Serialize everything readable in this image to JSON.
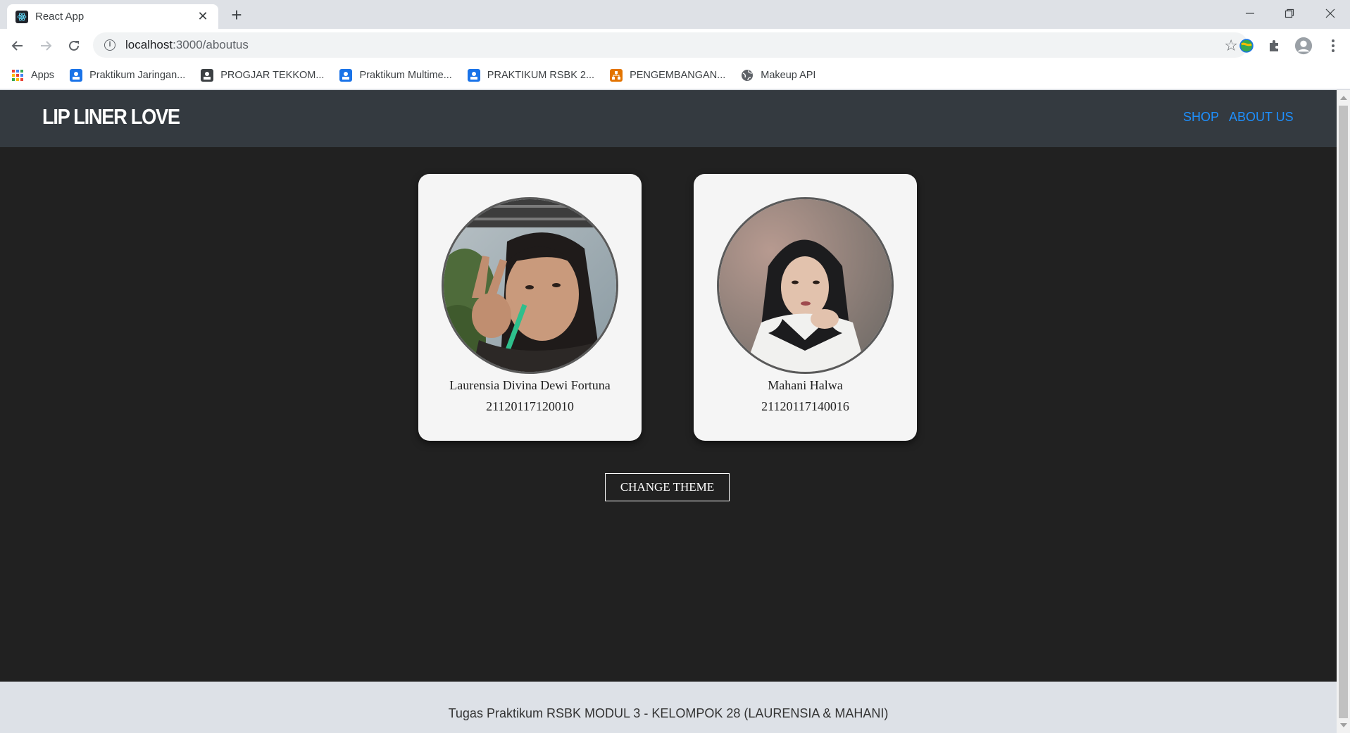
{
  "browser": {
    "tab_title": "React App",
    "url_host": "localhost",
    "url_rest": ":3000/aboutus",
    "bookmarks": [
      {
        "label": "Apps",
        "icon": "apps-grid-icon",
        "color": "#ea4335"
      },
      {
        "label": "Praktikum Jaringan...",
        "icon": "classroom-icon",
        "color": "#1a73e8"
      },
      {
        "label": "PROGJAR TEKKOM...",
        "icon": "classroom-icon",
        "color": "#3c4043"
      },
      {
        "label": "Praktikum Multime...",
        "icon": "classroom-icon",
        "color": "#1a73e8"
      },
      {
        "label": "PRAKTIKUM RSBK 2...",
        "icon": "classroom-icon",
        "color": "#1a73e8"
      },
      {
        "label": "PENGEMBANGAN...",
        "icon": "org-icon",
        "color": "#e37400"
      },
      {
        "label": "Makeup API",
        "icon": "globe-icon",
        "color": "#5f6368"
      }
    ]
  },
  "navbar": {
    "brand": "LIP LINER LOVE",
    "links": [
      "SHOP",
      "ABOUT US"
    ]
  },
  "members": [
    {
      "name": "Laurensia Divina Dewi Fortuna",
      "id": "21120117120010"
    },
    {
      "name": "Mahani Halwa",
      "id": "21120117140016"
    }
  ],
  "theme_button": "CHANGE THEME",
  "footer": "Tugas Praktikum RSBK MODUL 3 - KELOMPOK 28 (LAURENSIA & MAHANI)",
  "colors": {
    "page_bg": "#212121",
    "navbar_bg": "#343a40",
    "link": "#1e90ff",
    "card_bg": "#f5f5f5",
    "footer_bg": "#dde1e7"
  }
}
